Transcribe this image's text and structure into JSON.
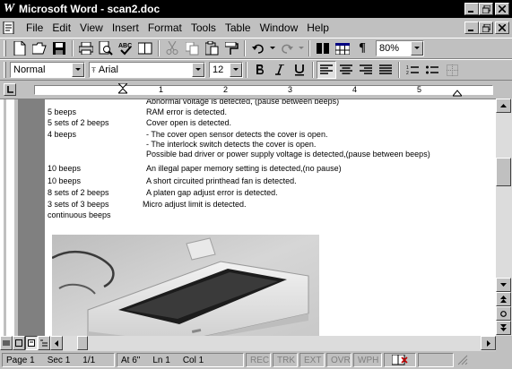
{
  "window": {
    "app_icon": "W",
    "title": "Microsoft Word - scan2.doc"
  },
  "menu": {
    "items": [
      {
        "label": "File"
      },
      {
        "label": "Edit"
      },
      {
        "label": "View"
      },
      {
        "label": "Insert"
      },
      {
        "label": "Format"
      },
      {
        "label": "Tools"
      },
      {
        "label": "Table"
      },
      {
        "label": "Window"
      },
      {
        "label": "Help"
      }
    ]
  },
  "toolbar": {
    "zoom": "80%"
  },
  "formatting": {
    "style": "Normal",
    "font": "Arial",
    "size": "12"
  },
  "ruler": {
    "numbers": [
      "1",
      "2",
      "3",
      "4",
      "5"
    ]
  },
  "document": {
    "top_partial": "Abnormal voltage is detected, (pause between beeps)",
    "rows": [
      {
        "count": "5 beeps",
        "meaning": "RAM error is detected."
      },
      {
        "count": "5 sets of 2 beeps",
        "meaning": "Cover open is detected."
      },
      {
        "count": "4 beeps",
        "meaning": "- The cover open sensor detects the cover is open."
      },
      {
        "count": "",
        "meaning": "- The interlock switch detects the cover is open."
      },
      {
        "count": "",
        "meaning": "Possible bad driver or power supply voltage is detected,(pause between beeps)"
      },
      {
        "count": "10 beeps",
        "meaning": "An illegal paper memory setting is detected,(no pause)"
      },
      {
        "count": "10 beeps",
        "meaning": "A short circuited printhead fan is detected."
      },
      {
        "count": "8 sets of 2 beeps",
        "meaning": "A platen gap adjust error is detected."
      },
      {
        "count": "3 sets of 3 beeps",
        "meaning": "Micro adjust limit is detected."
      },
      {
        "count": "continuous beeps",
        "meaning": ""
      }
    ]
  },
  "status": {
    "page": "Page 1",
    "sec": "Sec 1",
    "pages": "1/1",
    "at": "At 6\"",
    "ln": "Ln 1",
    "col": "Col 1",
    "modes": [
      "REC",
      "TRK",
      "EXT",
      "OVR",
      "WPH"
    ]
  }
}
